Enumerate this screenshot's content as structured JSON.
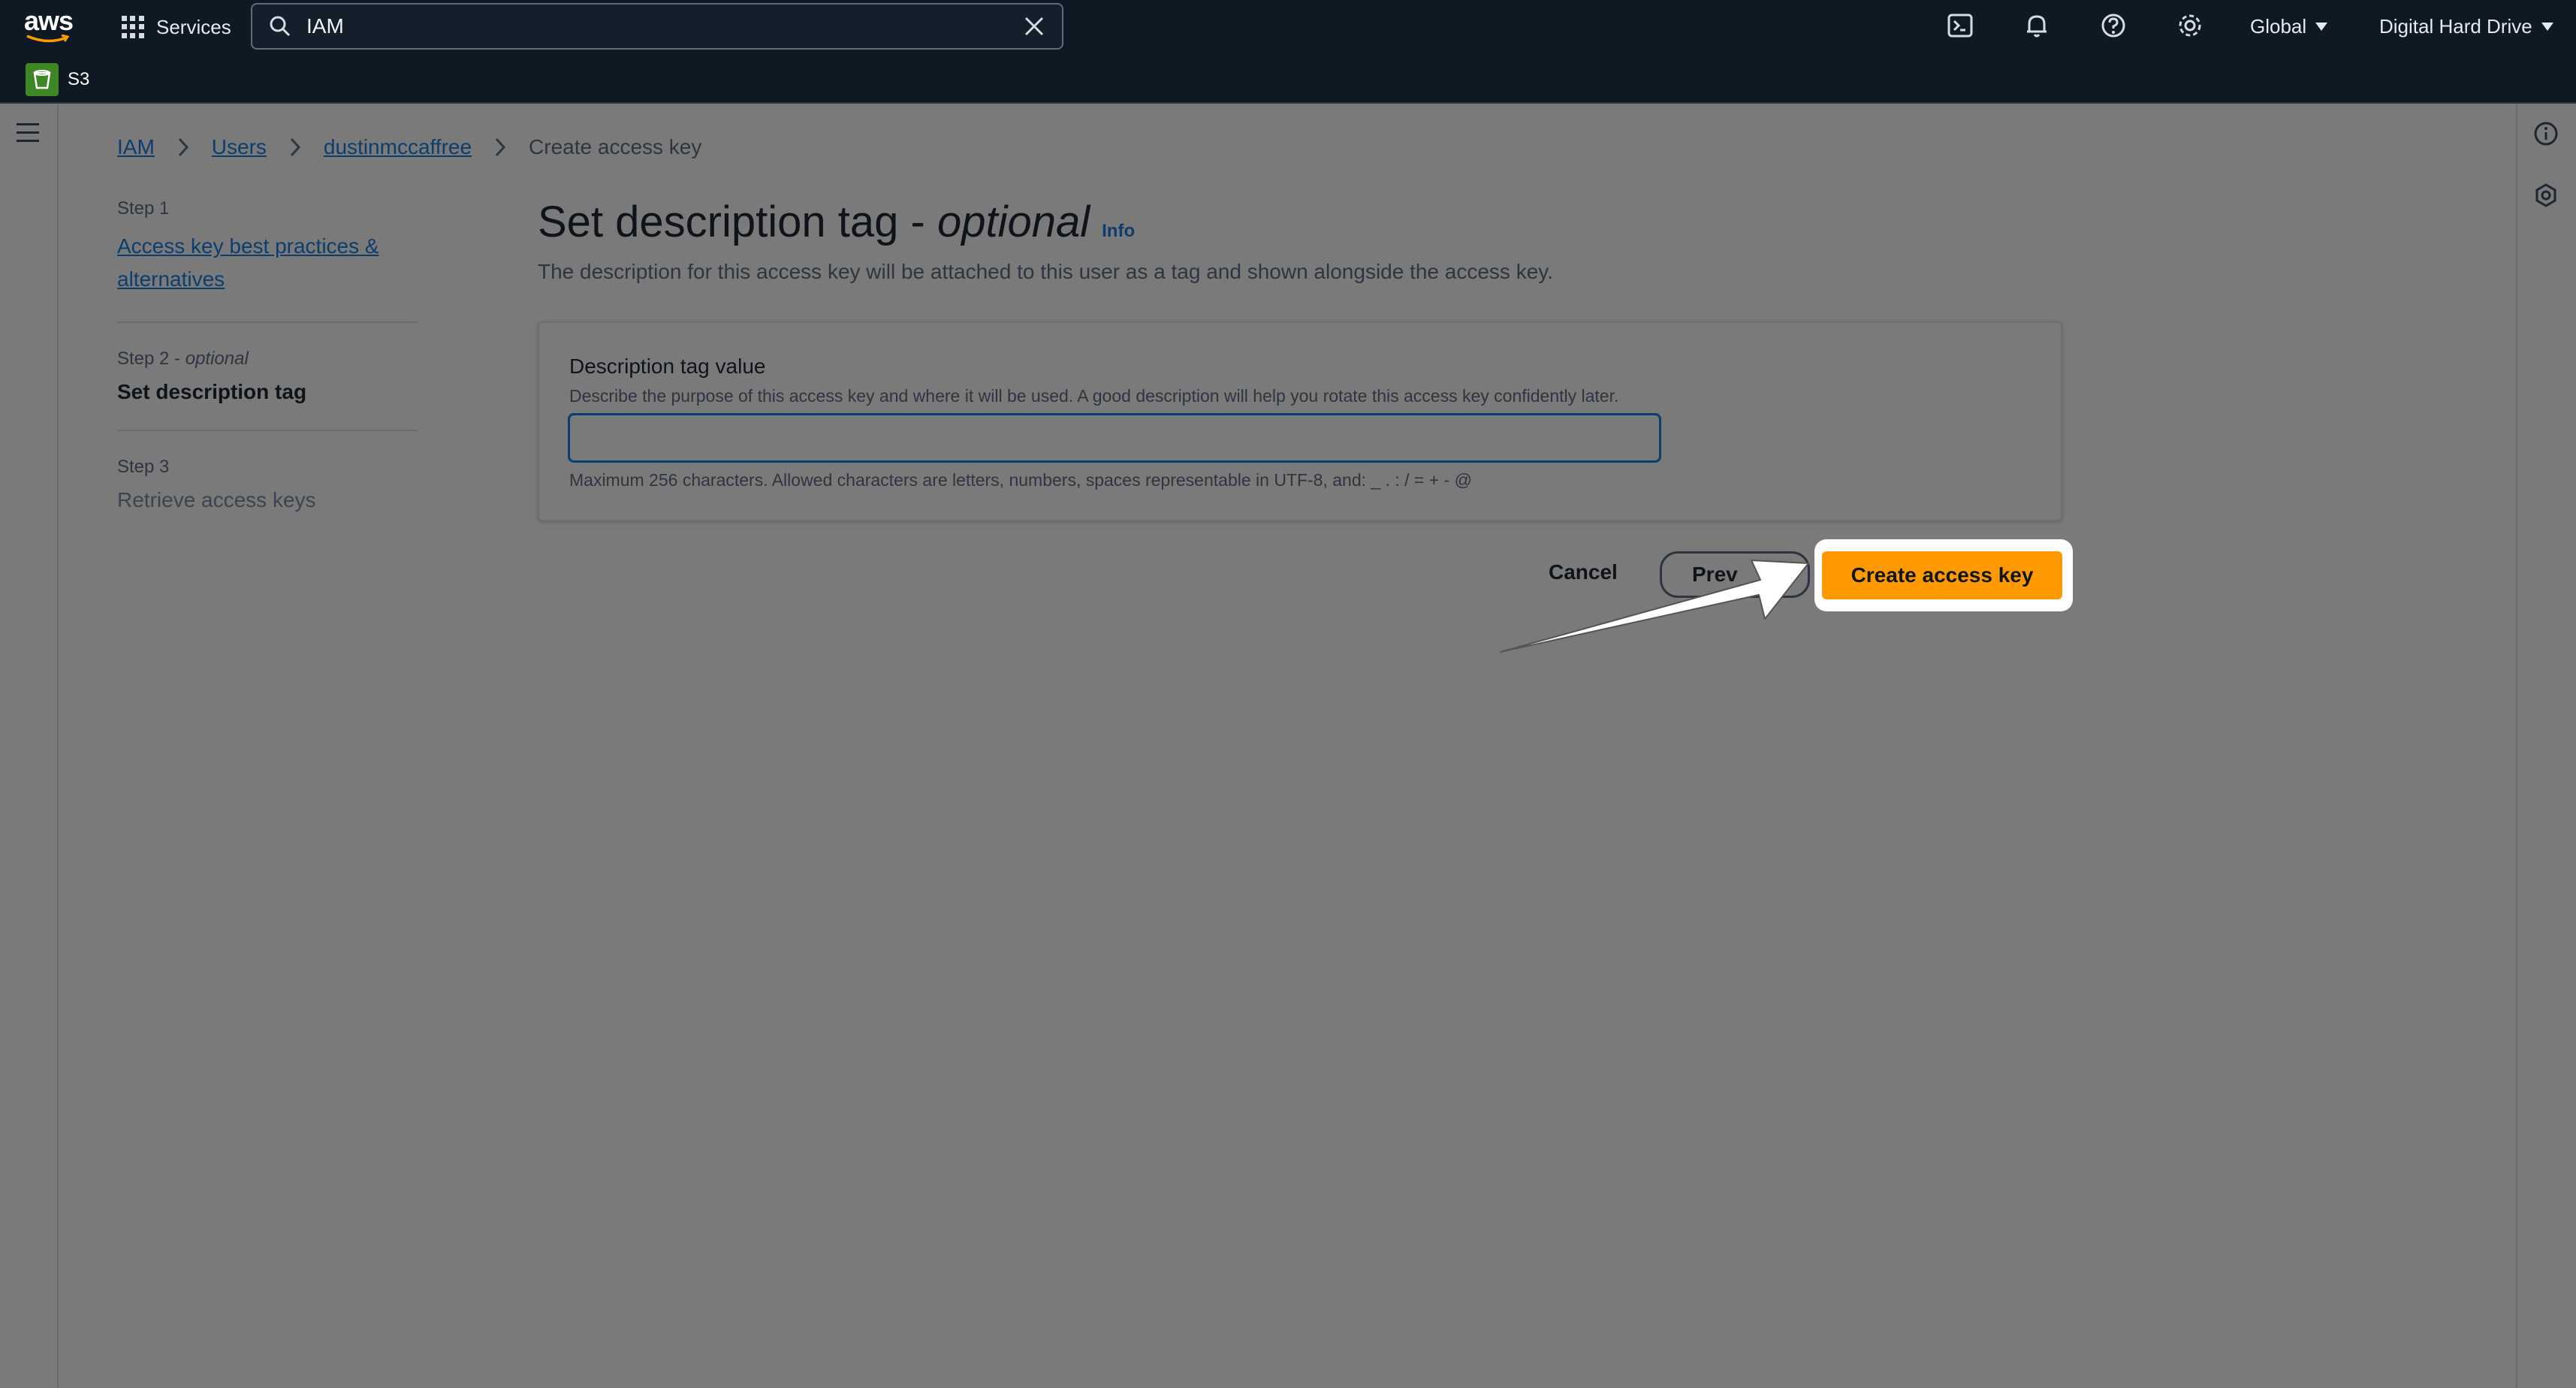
{
  "topnav": {
    "logo_text": "aws",
    "services_label": "Services",
    "search_value": "IAM",
    "icons": [
      "cloudshell-icon",
      "bell-icon",
      "help-icon",
      "gear-icon"
    ],
    "region_label": "Global",
    "account_label": "Digital Hard Drive"
  },
  "favorites": [
    {
      "label": "S3",
      "icon": "s3-icon"
    }
  ],
  "breadcrumb": {
    "items": [
      "IAM",
      "Users",
      "dustinmccaffree"
    ],
    "current": "Create access key"
  },
  "steps": [
    {
      "number": "Step 1",
      "title": "Access key best practices & alternatives",
      "state": "link"
    },
    {
      "number": "Step 2",
      "qualifier": "optional",
      "title": "Set description tag",
      "state": "current"
    },
    {
      "number": "Step 3",
      "title": "Retrieve access keys",
      "state": "disabled"
    }
  ],
  "page": {
    "title_prefix": "Set description tag - ",
    "title_optional": "optional",
    "info_label": "Info",
    "subtitle": "The description for this access key will be attached to this user as a tag and shown alongside the access key."
  },
  "form": {
    "label": "Description tag value",
    "description": "Describe the purpose of this access key and where it will be used. A good description will help you rotate this access key confidently later.",
    "value": "",
    "constraint": "Maximum 256 characters. Allowed characters are letters, numbers, spaces representable in UTF-8, and: _ . : / = + - @"
  },
  "actions": {
    "cancel_label": "Cancel",
    "previous_label": "Prev",
    "create_label": "Create access key"
  },
  "colors": {
    "nav_bg": "#0f1923",
    "overlay_bg": "#7a7a7a",
    "primary_button": "#ff9900",
    "link": "#0b3e6e"
  }
}
